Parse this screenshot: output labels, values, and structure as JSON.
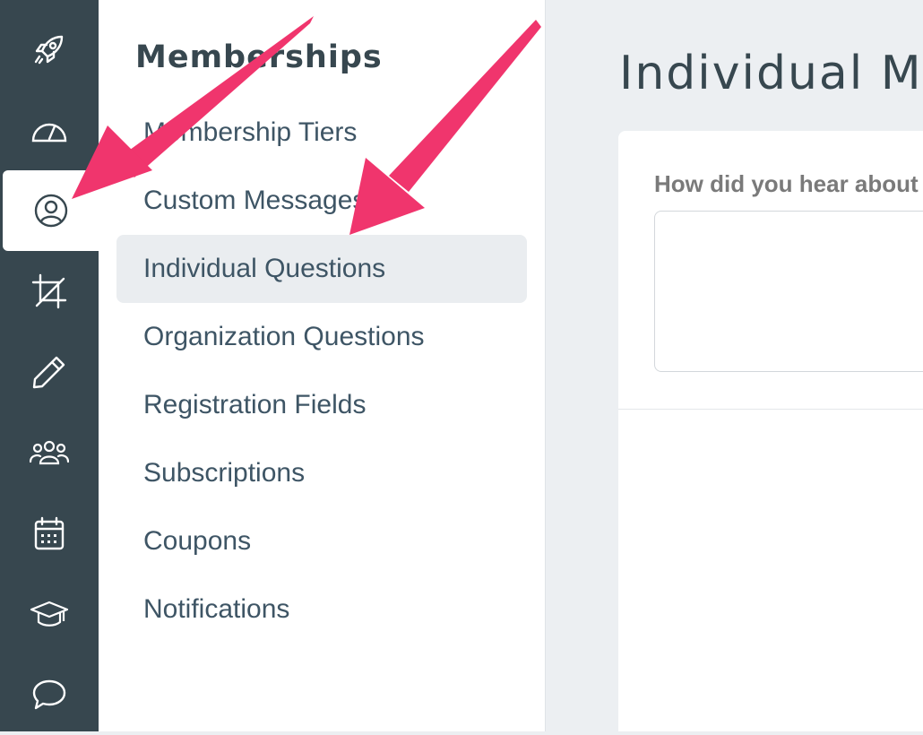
{
  "rail": {
    "icons": [
      "rocket-icon",
      "dashboard-gauge-icon",
      "user-circle-icon",
      "crop-icon",
      "pencil-icon",
      "users-group-icon",
      "calendar-icon",
      "graduation-cap-icon",
      "chat-bubble-icon"
    ],
    "active": "user-circle-icon"
  },
  "subnav": {
    "title": "Memberships",
    "items": [
      {
        "label": "Membership Tiers"
      },
      {
        "label": "Custom Messages"
      },
      {
        "label": "Individual Questions",
        "active": true
      },
      {
        "label": "Organization Questions"
      },
      {
        "label": "Registration Fields"
      },
      {
        "label": "Subscriptions"
      },
      {
        "label": "Coupons"
      },
      {
        "label": "Notifications"
      }
    ]
  },
  "main": {
    "title": "Individual Membership Questions",
    "question_label": "How did you hear about us?",
    "answer_value": ""
  },
  "colors": {
    "rail_bg": "#37474f",
    "annotation_arrow": "#f0356d",
    "active_bg": "#eaedf0"
  }
}
